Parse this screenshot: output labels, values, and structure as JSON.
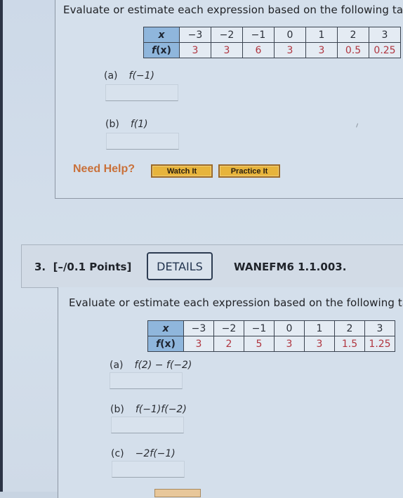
{
  "question2": {
    "prompt": "Evaluate or estimate each expression based on the following table.",
    "table": {
      "x_header": "x",
      "fx_header_f": "f",
      "fx_header_rest": "(x)",
      "x_values": [
        "−3",
        "−2",
        "−1",
        "0",
        "1",
        "2",
        "3"
      ],
      "f_values": [
        "3",
        "3",
        "6",
        "3",
        "3",
        "0.5",
        "0.25"
      ]
    },
    "parts": [
      {
        "label": "(a)",
        "expression": "f(−1)",
        "answer": ""
      },
      {
        "label": "(b)",
        "expression": "f(1)",
        "answer": ""
      }
    ],
    "help": {
      "label": "Need Help?",
      "watch_label": "Watch It",
      "practice_label": "Practice It"
    }
  },
  "question3": {
    "number": "3.",
    "points": "[–/0.1 Points]",
    "details_label": "DETAILS",
    "code": "WANEFM6 1.1.003.",
    "prompt": "Evaluate or estimate each expression based on the following table. H",
    "table": {
      "x_header": "x",
      "fx_header_f": "f",
      "fx_header_rest": "(x)",
      "x_values": [
        "−3",
        "−2",
        "−1",
        "0",
        "1",
        "2",
        "3"
      ],
      "f_values": [
        "3",
        "2",
        "5",
        "3",
        "3",
        "1.5",
        "1.25"
      ]
    },
    "parts": [
      {
        "label": "(a)",
        "expression": "f(2) − f(−2)",
        "answer": ""
      },
      {
        "label": "(b)",
        "expression": "f(−1)f(−2)",
        "answer": ""
      },
      {
        "label": "(c)",
        "expression": "−2f(−1)",
        "answer": ""
      }
    ]
  },
  "colors": {
    "table_header_bg": "#8fb6dc",
    "table_value_color": "#b0353f",
    "need_help_color": "#c9713a",
    "help_button_bg": "#e7b43c"
  }
}
